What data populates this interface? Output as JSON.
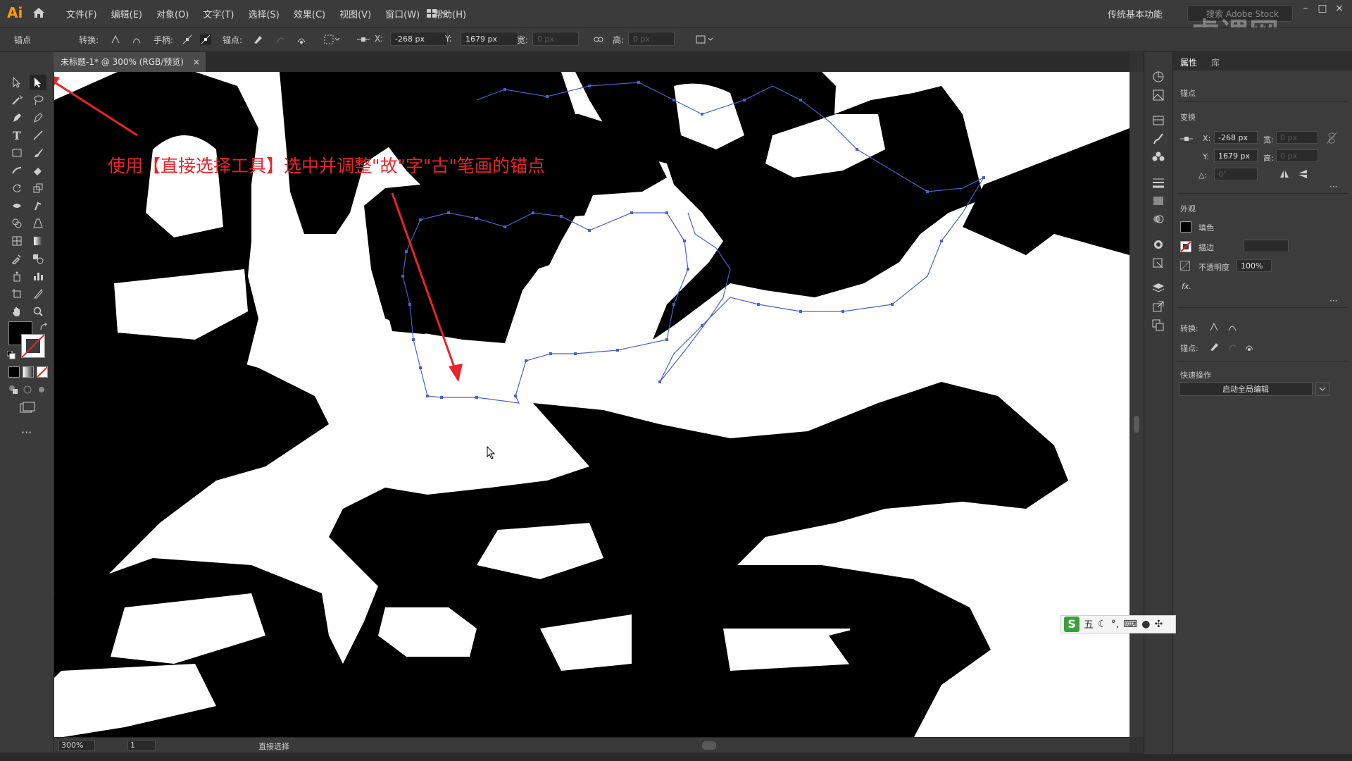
{
  "app": {
    "logo": "Ai"
  },
  "menu": [
    "文件(F)",
    "编辑(E)",
    "对象(O)",
    "文字(T)",
    "选择(S)",
    "效果(C)",
    "视图(V)",
    "窗口(W)",
    "帮助(H)"
  ],
  "workspace": "传统基本功能",
  "search_placeholder": "搜索 Adobe Stock",
  "watermark": "虎课网",
  "controlbar": {
    "anchor_label": "锚点",
    "convert_label": "转换:",
    "handle_label": "手柄:",
    "anchor2_label": "锚点:",
    "x_label": "X:",
    "x_value": "-268 px",
    "y_label": "Y:",
    "y_value": "1679 px",
    "w_label": "宽:",
    "w_value": "0 px",
    "h_label": "高:",
    "h_value": "0 px"
  },
  "document_tab": {
    "title": "未标题-1* @ 300% (RGB/预览)",
    "close": "×"
  },
  "annotation": "使用【直接选择工具】选中并调整\"故\"字\"古\"笔画的锚点",
  "statusbar": {
    "zoom": "300%",
    "page": "1",
    "tool": "直接选择"
  },
  "properties_panel": {
    "tabs": [
      "属性",
      "库"
    ],
    "section_anchor": "锚点",
    "section_transform": "变换",
    "x_label": "X:",
    "x_value": "-268 px",
    "y_label": "Y:",
    "y_value": "1679 px",
    "w_label": "宽:",
    "w_value": "0 px",
    "h_label": "高:",
    "h_value": "0 px",
    "angle_label": "△:",
    "angle_value": "0°",
    "section_appearance": "外观",
    "fill_label": "填色",
    "stroke_label": "描边",
    "opacity_label": "不透明度",
    "opacity_value": "100%",
    "fx_label": "fx.",
    "convert_label": "转换:",
    "anchor_label": "锚点:",
    "section_quick": "快速操作",
    "global_edit_button": "启动全局编辑"
  },
  "ime": {
    "logo": "S",
    "mode": "五"
  },
  "colors": {
    "annotation": "#e8232a",
    "selection": "#4a5fd0",
    "ai_orange": "#ff9a00"
  }
}
